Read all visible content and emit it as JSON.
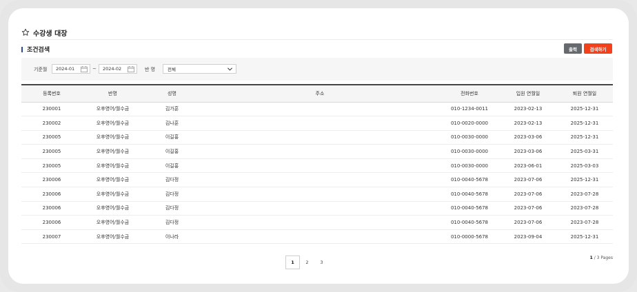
{
  "header": {
    "title": "수강생 대장",
    "icon": "star-outline-icon"
  },
  "section": {
    "title": "조건검색"
  },
  "toolbar": {
    "print_label": "출력",
    "search_label": "검색하기",
    "print_color": "#666a6e",
    "search_color": "#f2411b"
  },
  "filter": {
    "date_label": "기준월",
    "start": "2024-01",
    "tilde": "~",
    "end": "2024-02",
    "class_label": "반 명",
    "class_value": "전체"
  },
  "table": {
    "columns": [
      "등록번호",
      "반명",
      "성명",
      "주소",
      "전화번호",
      "입원 연월일",
      "퇴원 연월일"
    ],
    "rows": [
      [
        "230001",
        "오후영어/월수금",
        "김가훈",
        "",
        "010-1234-0011",
        "2023-02-13",
        "2025-12-31"
      ],
      [
        "230002",
        "오후영어/월수금",
        "김나훈",
        "",
        "010-0020-0000",
        "2023-02-13",
        "2025-12-31"
      ],
      [
        "230005",
        "오후영어/월수금",
        "이길홍",
        "",
        "010-0030-0000",
        "2023-03-06",
        "2025-12-31"
      ],
      [
        "230005",
        "오후영어/월수금",
        "이길홍",
        "",
        "010-0030-0000",
        "2023-03-06",
        "2025-03-31"
      ],
      [
        "230005",
        "오후영어/월수금",
        "이길홍",
        "",
        "010-0030-0000",
        "2023-06-01",
        "2025-03-03"
      ],
      [
        "230006",
        "오후영어/월수금",
        "김다정",
        "",
        "010-0040-5678",
        "2023-07-06",
        "2025-12-31"
      ],
      [
        "230006",
        "오후영어/월수금",
        "김다정",
        "",
        "010-0040-5678",
        "2023-07-06",
        "2023-07-28"
      ],
      [
        "230006",
        "오후영어/월수금",
        "김다정",
        "",
        "010-0040-5678",
        "2023-07-06",
        "2023-07-28"
      ],
      [
        "230006",
        "오후영어/월수금",
        "김다정",
        "",
        "010-0040-5678",
        "2023-07-06",
        "2023-07-28"
      ],
      [
        "230007",
        "오후영어/월수금",
        "이나라",
        "",
        "010-0000-5678",
        "2023-09-04",
        "2025-12-31"
      ]
    ]
  },
  "pagination": {
    "pages": [
      "1",
      "2",
      "3"
    ],
    "current": "1",
    "info_current": "1",
    "info_rest": " / 3 Pages"
  }
}
